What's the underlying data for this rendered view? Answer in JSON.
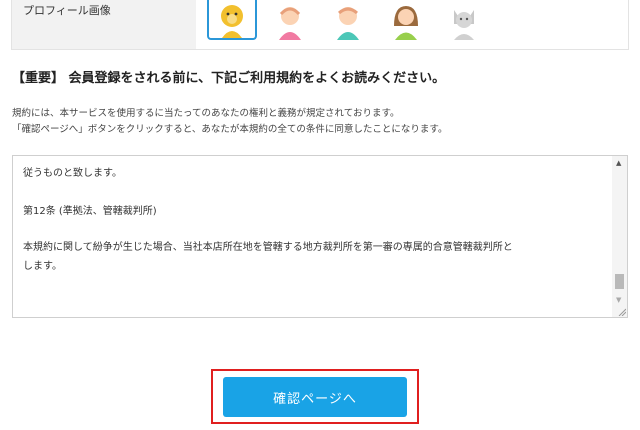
{
  "profile": {
    "label": "プロフィール画像",
    "avatars": [
      {
        "icon": "bear-avatar-icon",
        "selected": true
      },
      {
        "icon": "girl-avatar-icon",
        "selected": false
      },
      {
        "icon": "boy-avatar-icon",
        "selected": false
      },
      {
        "icon": "woman-avatar-icon",
        "selected": false
      },
      {
        "icon": "cat-avatar-icon",
        "selected": false
      }
    ]
  },
  "notice": "【重要】 会員登録をされる前に、下記ご利用規約をよくお読みください。",
  "description": {
    "line1": "規約には、本サービスを使用するに当たってのあなたの権利と義務が規定されております。",
    "line2": "「確認ページへ」ボタンをクリックすると、あなたが本規約の全ての条件に同意したことになります。"
  },
  "terms": {
    "line1": "従うものと致します。",
    "line2": "第12条 (準拠法、管轄裁判所)",
    "line3": "本規約に関して紛争が生じた場合、当社本店所在地を管轄する地方裁判所を第一審の専属的合意管轄裁判所と",
    "line4": "します。"
  },
  "confirm_button": "確認ページへ",
  "colors": {
    "accent": "#19a3e6",
    "highlight": "#e01f1f",
    "selected_border": "#2b97d8"
  }
}
